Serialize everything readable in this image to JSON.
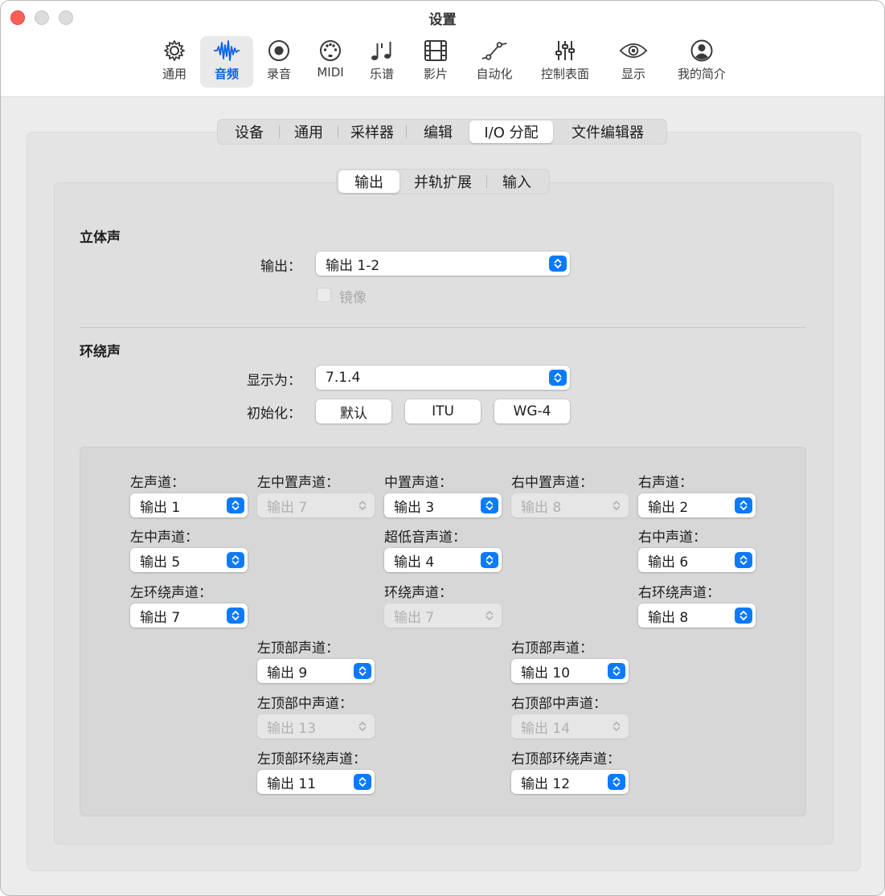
{
  "window": {
    "title": "设置"
  },
  "toolbar": {
    "items": [
      {
        "label": "通用",
        "icon": "gear-icon"
      },
      {
        "label": "音频",
        "icon": "waveform-icon",
        "active": true
      },
      {
        "label": "录音",
        "icon": "record-icon"
      },
      {
        "label": "MIDI",
        "icon": "midi-icon"
      },
      {
        "label": "乐谱",
        "icon": "music-notes-icon"
      },
      {
        "label": "影片",
        "icon": "film-icon"
      },
      {
        "label": "自动化",
        "icon": "automation-icon"
      },
      {
        "label": "控制表面",
        "icon": "sliders-icon"
      },
      {
        "label": "显示",
        "icon": "eye-icon"
      },
      {
        "label": "我的简介",
        "icon": "person-icon"
      }
    ]
  },
  "tabs": {
    "items": [
      "设备",
      "通用",
      "采样器",
      "编辑",
      "I/O 分配",
      "文件编辑器"
    ],
    "selected": "I/O 分配"
  },
  "subtabs": {
    "items": [
      "输出",
      "并轨扩展",
      "输入"
    ],
    "selected": "输出"
  },
  "stereo": {
    "title": "立体声",
    "output_label": "输出：",
    "output_value": "输出 1-2",
    "mirror_label": "镜像"
  },
  "surround": {
    "title": "环绕声",
    "display_label": "显示为：",
    "display_value": "7.1.4",
    "init_label": "初始化：",
    "init_buttons": [
      "默认",
      "ITU",
      "WG-4"
    ]
  },
  "channels": {
    "left": {
      "label": "左声道：",
      "value": "输出 1",
      "enabled": true
    },
    "left_center": {
      "label": "左中置声道：",
      "value": "输出 7",
      "enabled": false
    },
    "center": {
      "label": "中置声道：",
      "value": "输出 3",
      "enabled": true
    },
    "right_center": {
      "label": "右中置声道：",
      "value": "输出 8",
      "enabled": false
    },
    "right": {
      "label": "右声道：",
      "value": "输出 2",
      "enabled": true
    },
    "left_middle": {
      "label": "左中声道：",
      "value": "输出 5",
      "enabled": true
    },
    "lfe": {
      "label": "超低音声道：",
      "value": "输出 4",
      "enabled": true
    },
    "right_middle": {
      "label": "右中声道：",
      "value": "输出 6",
      "enabled": true
    },
    "left_surround": {
      "label": "左环绕声道：",
      "value": "输出 7",
      "enabled": true
    },
    "surround": {
      "label": "环绕声道：",
      "value": "输出 7",
      "enabled": false
    },
    "right_surround": {
      "label": "右环绕声道：",
      "value": "输出 8",
      "enabled": true
    },
    "left_top": {
      "label": "左顶部声道：",
      "value": "输出 9",
      "enabled": true
    },
    "right_top": {
      "label": "右顶部声道：",
      "value": "输出 10",
      "enabled": true
    },
    "left_top_middle": {
      "label": "左顶部中声道：",
      "value": "输出 13",
      "enabled": false
    },
    "right_top_middle": {
      "label": "右顶部中声道：",
      "value": "输出 14",
      "enabled": false
    },
    "left_top_surround": {
      "label": "左顶部环绕声道：",
      "value": "输出 11",
      "enabled": true
    },
    "right_top_surround": {
      "label": "右顶部环绕声道：",
      "value": "输出 12",
      "enabled": true
    }
  },
  "colors": {
    "accent": "#0a7aff",
    "close": "#fe5f57"
  }
}
